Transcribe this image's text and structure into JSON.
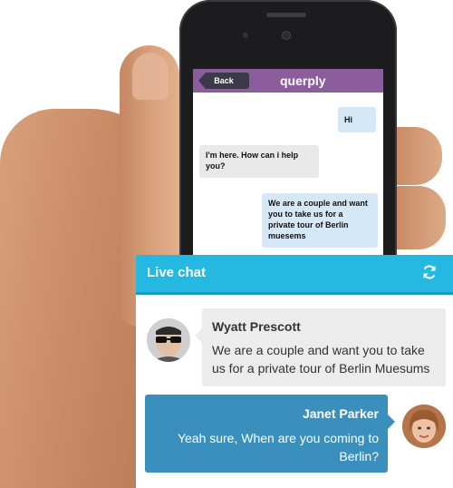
{
  "phone": {
    "back_label": "Back",
    "app_title": "querply",
    "messages": [
      {
        "direction": "out",
        "text": "Hi"
      },
      {
        "direction": "in",
        "text": "I'm here. How can i help you?"
      },
      {
        "direction": "out",
        "text": "We are a couple and want you to take us for a private tour of Berlin muesems"
      }
    ]
  },
  "widget": {
    "title": "Live chat",
    "header_color": "#25b8e0",
    "refresh_icon": "refresh-icon",
    "messages": [
      {
        "sender": "Wyatt Prescott",
        "text": "We are a couple and want you to take us for a private tour of Berlin Muesums"
      },
      {
        "sender": "Janet Parker",
        "text": "Yeah sure, When are you coming to Berlin?"
      }
    ]
  },
  "colors": {
    "phone_app_bar": "#8b5d9d",
    "outgoing_bubble": "#3a8fbd",
    "incoming_bubble": "#ececec"
  }
}
